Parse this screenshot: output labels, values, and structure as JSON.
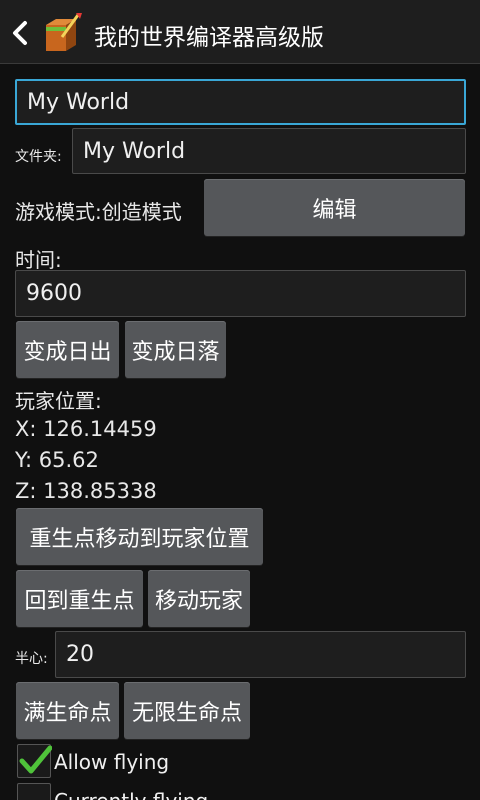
{
  "actionbar": {
    "title": "我的世界编译器高级版"
  },
  "world": {
    "name_value": "My World",
    "folder_label": "文件夹:",
    "folder_value": "My World",
    "gamemode_text": "游戏模式:创造模式",
    "edit_label": "编辑"
  },
  "time": {
    "label": "时间:",
    "value": "9600",
    "sunrise_label": "变成日出",
    "sunset_label": "变成日落"
  },
  "player": {
    "position_label": "玩家位置:",
    "x_text": "X: 126.14459",
    "y_text": "Y: 65.62",
    "z_text": "Z: 138.85338",
    "move_spawn_label": "重生点移动到玩家位置",
    "goto_spawn_label": "回到重生点",
    "move_player_label": "移动玩家"
  },
  "health": {
    "half_heart_label": "半心:",
    "value": "20",
    "full_health_label": "满生命点",
    "infinite_health_label": "无限生命点"
  },
  "flags": {
    "allow_flying_label": "Allow flying",
    "allow_flying_checked": true,
    "currently_flying_label": "Currently flying",
    "currently_flying_checked": false
  },
  "colors": {
    "accent": "#3aa7d6",
    "check": "#4fc33a"
  }
}
